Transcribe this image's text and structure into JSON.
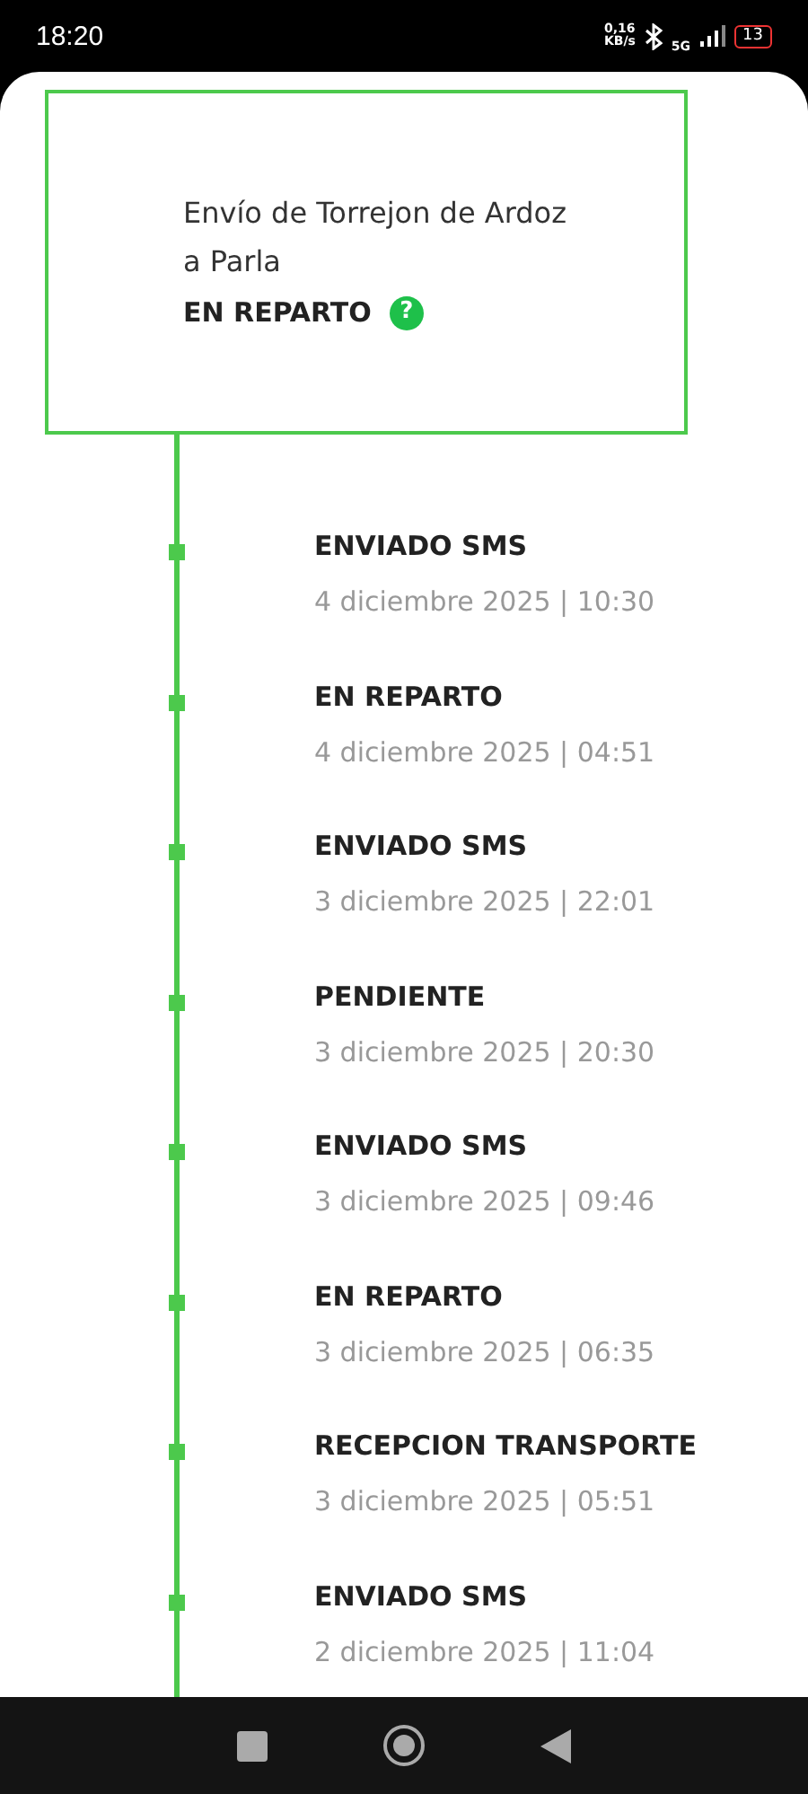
{
  "status_bar": {
    "time": "18:20",
    "speed_value": "0,16",
    "speed_unit": "KB/s",
    "network": "5G",
    "battery": "13"
  },
  "shipment": {
    "route_line_1": "Envío de Torrejon de Ardoz",
    "route_line_2": "a Parla",
    "status": "EN REPARTO",
    "help_icon": "?"
  },
  "events": [
    {
      "title": "ENVIADO SMS",
      "date": "4 diciembre 2025 | 10:30"
    },
    {
      "title": "EN REPARTO",
      "date": "4 diciembre 2025 | 04:51"
    },
    {
      "title": "ENVIADO SMS",
      "date": "3 diciembre 2025 | 22:01"
    },
    {
      "title": "PENDIENTE",
      "date": "3 diciembre 2025 | 20:30"
    },
    {
      "title": "ENVIADO SMS",
      "date": "3 diciembre 2025 | 09:46"
    },
    {
      "title": "EN REPARTO",
      "date": "3 diciembre 2025 | 06:35"
    },
    {
      "title": "RECEPCION TRANSPORTE",
      "date": "3 diciembre 2025 | 05:51"
    },
    {
      "title": "ENVIADO SMS",
      "date": "2 diciembre 2025 | 11:04"
    }
  ]
}
